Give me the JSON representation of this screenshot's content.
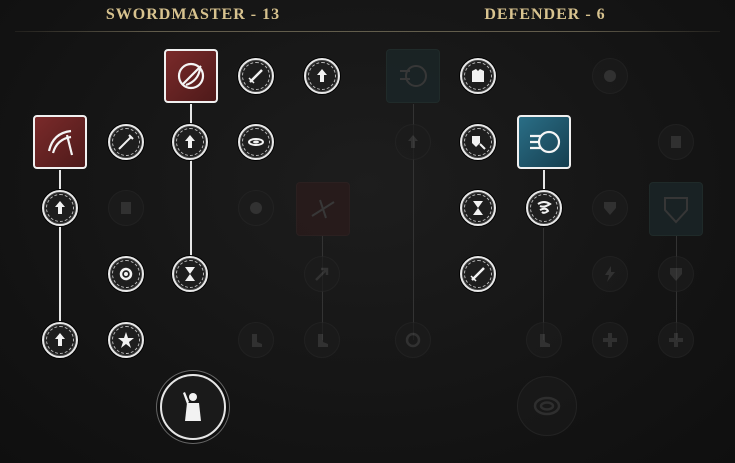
{
  "trees": {
    "swordmaster": {
      "name": "SWORDMASTER - 13"
    },
    "defender": {
      "name": "DEFENDER - 6"
    }
  },
  "icons": {
    "active_ability_1": "blade-spin-icon",
    "active_ability_2": "sword-slash-icon",
    "active_ability_3": "shield-rush-icon",
    "ultimate_1": "triumphant-warrior-icon",
    "ultimate_2": "shield-ring-icon"
  }
}
